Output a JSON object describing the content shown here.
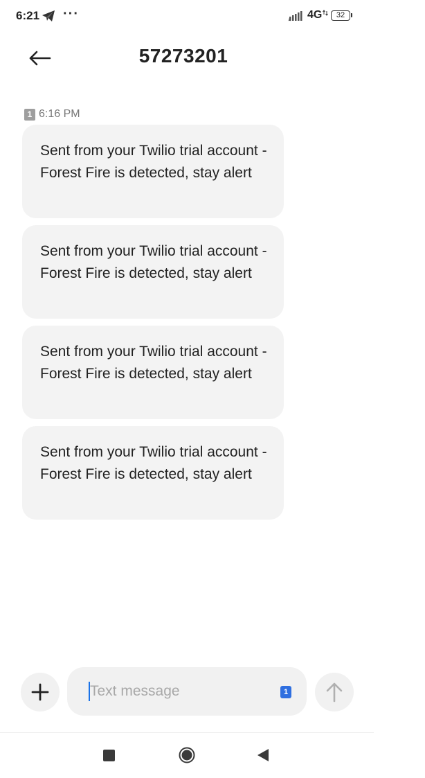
{
  "status_bar": {
    "time": "6:21",
    "more": "···",
    "network": "4G",
    "battery": "32"
  },
  "header": {
    "title": "57273201"
  },
  "conversation": {
    "sim_number": "1",
    "timestamp": "6:16 PM",
    "messages": [
      "Sent from your Twilio trial account - Forest Fire is detected, stay alert",
      "Sent from your Twilio trial account - Forest Fire is detected, stay alert",
      "Sent from your Twilio trial account - Forest Fire is detected, stay alert",
      "Sent from your Twilio trial account - Forest Fire is detected, stay alert"
    ]
  },
  "compose": {
    "placeholder": "Text message",
    "value": "",
    "sim_number": "1"
  },
  "icons": {
    "status": [
      "telegram-icon",
      "signal-icon",
      "battery-icon"
    ],
    "header": [
      "back-arrow-icon"
    ],
    "compose": [
      "plus-icon",
      "send-arrow-icon"
    ],
    "navigation": [
      "recent-apps-icon",
      "home-icon",
      "nav-back-icon"
    ]
  },
  "colors": {
    "bubble_background": "#f3f3f3",
    "accent": "#2f6fe0",
    "caret": "#1a73e8",
    "muted_text": "#777777"
  }
}
